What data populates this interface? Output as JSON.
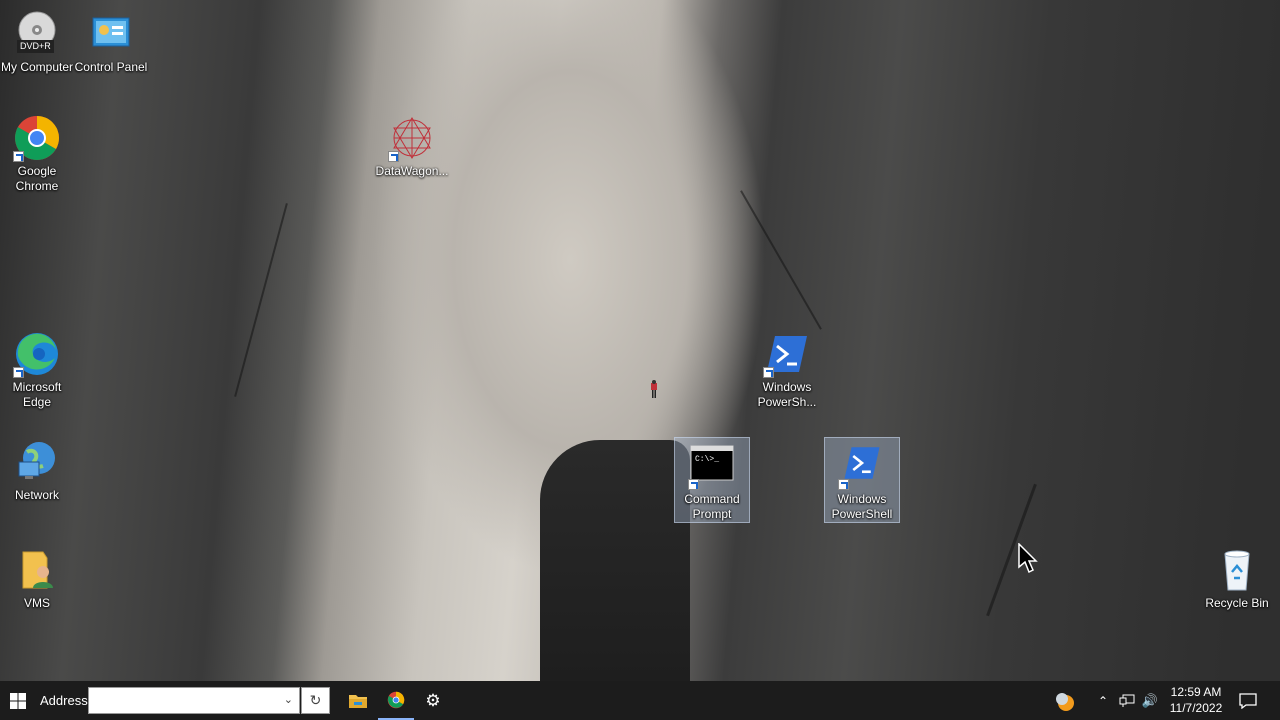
{
  "desktop": {
    "icons": {
      "my_computer": {
        "label": "My Computer",
        "badge": "DVD+R"
      },
      "control_panel": {
        "label": "Control Panel"
      },
      "google_chrome": {
        "label": "Google Chrome"
      },
      "datawagon": {
        "label": "DataWagon..."
      },
      "microsoft_edge": {
        "label": "Microsoft Edge"
      },
      "network": {
        "label": "Network"
      },
      "vms": {
        "label": "VMS"
      },
      "windows_powershell_1": {
        "label": "Windows PowerSh..."
      },
      "command_prompt": {
        "label": "Command Prompt",
        "screen_text": "C:\\>_"
      },
      "windows_powershell_2": {
        "label": "Windows PowerShell"
      },
      "recycle_bin": {
        "label": "Recycle Bin"
      }
    }
  },
  "taskbar": {
    "address_label": "Address",
    "address_value": "",
    "pinned": [
      "file-explorer-icon",
      "chrome-icon",
      "settings-gear-icon"
    ],
    "tray": [
      "weather-icon",
      "chevron-up-icon",
      "network-icon",
      "volume-icon",
      "notification-icon"
    ],
    "clock": {
      "time": "12:59 AM",
      "date": "11/7/2022"
    }
  },
  "colors": {
    "taskbar_bg": "#1c1c1c",
    "powershell_blue": "#2d6fd6",
    "selection": "#b4c8e6"
  }
}
